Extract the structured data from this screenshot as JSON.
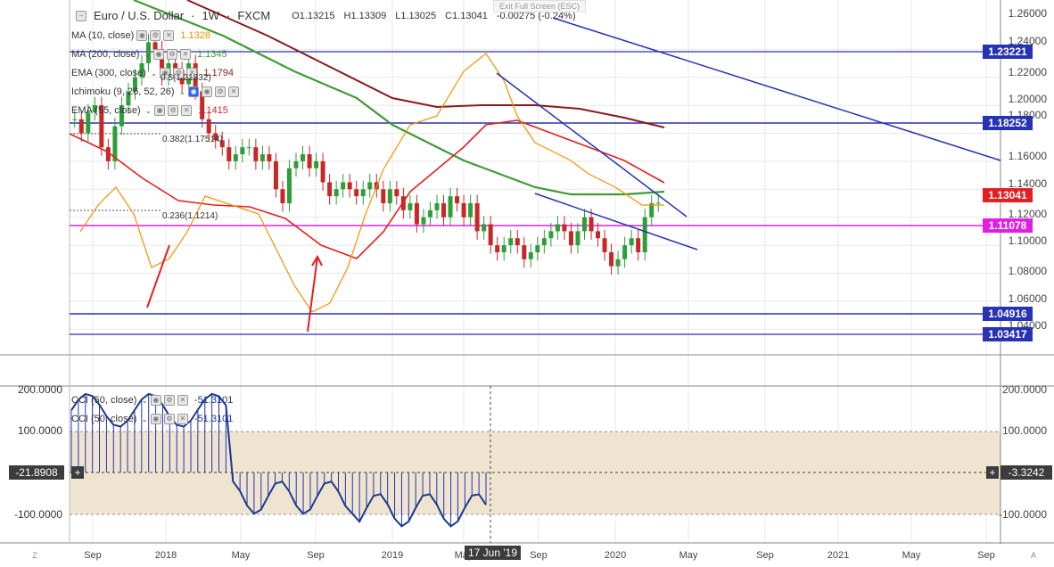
{
  "title": {
    "symbol": "Euro / U.S. Dollar",
    "interval": "1W",
    "exchange": "FXCM",
    "open": "O1.13215",
    "high": "H1.13309",
    "low": "L1.13025",
    "close": "C1.13041",
    "change": "-0.00275 (-0.24%)"
  },
  "exit_fullscreen": "Exit Full Screen (ESC)",
  "indicators": [
    {
      "name": "MA (10, close)",
      "value": "1.1328",
      "color": "#f39200"
    },
    {
      "name": "MA (200, close)",
      "value": "1.1345",
      "color": "#3f9c35"
    },
    {
      "name": "EMA (300, close)",
      "value": "1.1794",
      "color": "#8b1a1a"
    },
    {
      "name": "Ichimoku (9, 26, 52, 26)",
      "value": "",
      "color": "#2962ff"
    },
    {
      "name": "EMA (55, close)",
      "value": "1.1415",
      "color": "#e32020"
    }
  ],
  "fib_labels": {
    "l05": "0.5(1.21832)",
    "l382": "0.382(1.17514)",
    "l236": "0.236(1.1214)"
  },
  "price_axis": [
    "1.26000",
    "1.24000",
    "1.22000",
    "1.20000",
    "1.18000",
    "1.16000",
    "1.14000",
    "1.12000",
    "1.10000",
    "1.08000",
    "1.06000",
    "1.04000"
  ],
  "price_tags": [
    {
      "label": "1.23221",
      "color": "#2732b5"
    },
    {
      "label": "1.18252",
      "color": "#2732b5"
    },
    {
      "label": "1.13041",
      "color": "#e32020"
    },
    {
      "label": "1.11078",
      "color": "#e020e0"
    },
    {
      "label": "1.04916",
      "color": "#2732b5"
    },
    {
      "label": "1.03417",
      "color": "#2732b5"
    }
  ],
  "oscillator": {
    "rows": [
      {
        "name": "CCI (50, close)",
        "value": "-51.3101"
      },
      {
        "name": "CCI (50, close)",
        "value": "-51.3101"
      }
    ],
    "axis": [
      "200.0000",
      "100.0000",
      "-100.0000"
    ],
    "cursor_value_left": "-21.8908",
    "cursor_value_right": "-3.3242",
    "band_color": "#efe4cf",
    "line_color": "#1a3a8f"
  },
  "time_axis": [
    "Sep",
    "2018",
    "May",
    "Sep",
    "2019",
    "May",
    "Sep",
    "2020",
    "May",
    "Sep",
    "2021",
    "May",
    "Sep"
  ],
  "cursor_date": "17 Jun '19",
  "corner_left": "Z",
  "corner_right": "A",
  "chart_data": {
    "type": "candlestick",
    "interval": "weekly",
    "symbol": "EURUSD",
    "ylim": [
      1.03,
      1.265
    ],
    "start": "Sep 2017",
    "end": "Mar 2020",
    "closes": [
      1.19,
      1.18,
      1.195,
      1.2,
      1.17,
      1.16,
      1.185,
      1.2,
      1.21,
      1.22,
      1.23,
      1.245,
      1.24,
      1.22,
      1.23,
      1.225,
      1.215,
      1.23,
      1.21,
      1.19,
      1.18,
      1.175,
      1.17,
      1.16,
      1.165,
      1.17,
      1.17,
      1.16,
      1.165,
      1.16,
      1.14,
      1.13,
      1.155,
      1.16,
      1.165,
      1.155,
      1.16,
      1.145,
      1.135,
      1.14,
      1.145,
      1.14,
      1.135,
      1.14,
      1.145,
      1.14,
      1.13,
      1.14,
      1.135,
      1.125,
      1.13,
      1.115,
      1.12,
      1.125,
      1.13,
      1.12,
      1.135,
      1.13,
      1.12,
      1.13,
      1.11,
      1.115,
      1.1,
      1.095,
      1.1,
      1.105,
      1.1,
      1.09,
      1.095,
      1.1,
      1.105,
      1.11,
      1.115,
      1.11,
      1.1,
      1.11,
      1.12,
      1.11,
      1.105,
      1.095,
      1.085,
      1.09,
      1.1,
      1.105,
      1.095,
      1.12,
      1.13,
      1.13041
    ]
  }
}
